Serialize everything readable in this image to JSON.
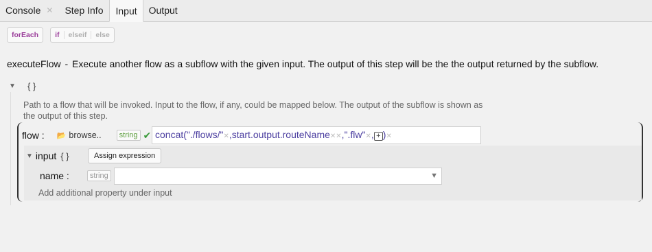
{
  "tabs": [
    {
      "label": "Console",
      "closable": true
    },
    {
      "label": "Step Info"
    },
    {
      "label": "Input",
      "active": true
    },
    {
      "label": "Output"
    }
  ],
  "controls": {
    "foreach": "forEach",
    "if": "if",
    "elseif": "elseif",
    "else": "else"
  },
  "step": {
    "name": "executeFlow",
    "separator": " - ",
    "description": "Execute another flow as a subflow with the given input. The output of this step will be the the output returned by the subflow."
  },
  "root": {
    "braces": "{ }",
    "help": "Path to a flow that will be invoked. Input to the flow, if any, could be mapped below. The output of the subflow is shown as the output of this step."
  },
  "flow": {
    "label": "flow :",
    "browse": "browse..",
    "type": "string",
    "expression": {
      "fn": "concat",
      "open": "(",
      "arg1": "\"./flows/\"",
      "arg2": "start.output.routeName",
      "arg3": "\".flw\"",
      "close": ")",
      "comma": ","
    }
  },
  "input": {
    "label": "input",
    "braces": "{ }",
    "assign_button": "Assign expression",
    "name_label": "name :",
    "name_type": "string",
    "name_value": "",
    "add_property": "Add additional property under input"
  },
  "colors": {
    "expression": "#4b3ea0",
    "type_valid": "#5a9d3a",
    "control_accent": "#9b3f9b"
  }
}
